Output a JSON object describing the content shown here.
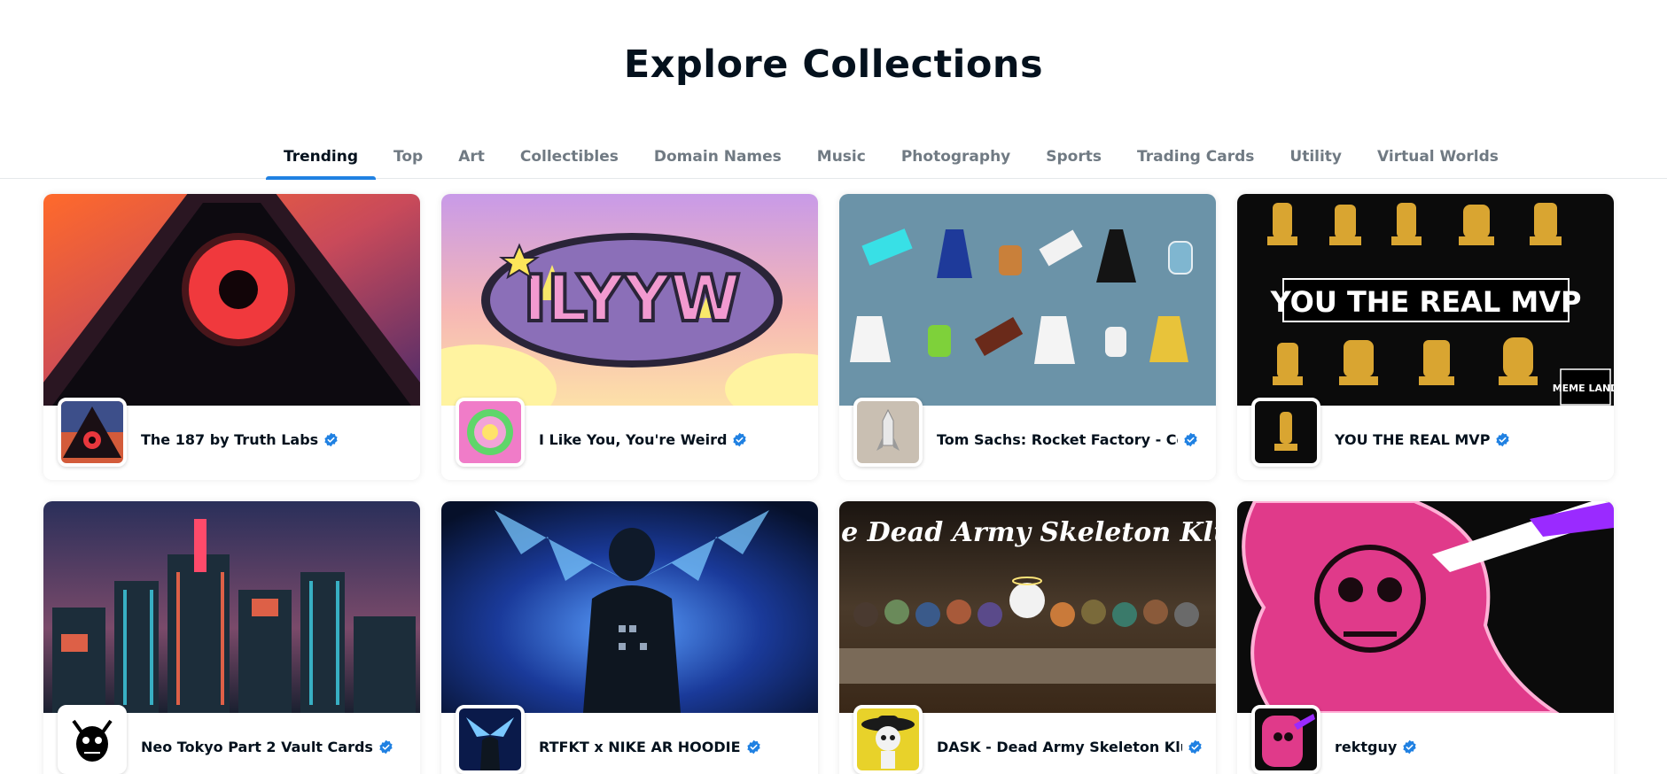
{
  "page": {
    "title": "Explore Collections"
  },
  "tabs": [
    {
      "label": "Trending",
      "active": true
    },
    {
      "label": "Top"
    },
    {
      "label": "Art"
    },
    {
      "label": "Collectibles"
    },
    {
      "label": "Domain Names"
    },
    {
      "label": "Music"
    },
    {
      "label": "Photography"
    },
    {
      "label": "Sports"
    },
    {
      "label": "Trading Cards"
    },
    {
      "label": "Utility"
    },
    {
      "label": "Virtual Worlds"
    }
  ],
  "collections": [
    {
      "name": "The 187 by Truth Labs",
      "verified": true,
      "banner_icon": "red-eye-pyramid-artwork",
      "avatar_icon": "pyramid-eye-avatar"
    },
    {
      "name": "I Like You, You're Weird",
      "verified": true,
      "banner_icon": "ilyyw-rainbow-logo-artwork",
      "banner_text": "ILYYW",
      "avatar_icon": "pink-green-badge-avatar"
    },
    {
      "name": "Tom Sachs: Rocket Factory - Com",
      "verified": true,
      "banner_icon": "rocket-parts-grid-artwork",
      "avatar_icon": "rocket-avatar"
    },
    {
      "name": "YOU THE REAL MVP",
      "verified": true,
      "banner_icon": "golden-trophies-artwork",
      "banner_text": "YOU THE REAL MVP",
      "banner_badge": "MEME LAND",
      "avatar_icon": "golden-trophy-avatar"
    },
    {
      "name": "Neo Tokyo Part 2 Vault Cards",
      "verified": true,
      "banner_icon": "neon-city-artwork",
      "avatar_icon": "demon-face-avatar"
    },
    {
      "name": "RTFKT x NIKE AR HOODIE",
      "verified": true,
      "banner_icon": "winged-hoodie-artwork",
      "avatar_icon": "winged-hoodie-avatar"
    },
    {
      "name": "DASK - Dead Army Skeleton Klub",
      "verified": true,
      "banner_icon": "skeleton-last-supper-artwork",
      "banner_text": "The Dead Army Skeleton Kluf.",
      "avatar_icon": "skeleton-sombrero-avatar"
    },
    {
      "name": "rektguy",
      "verified": true,
      "banner_icon": "pink-skull-ghost-artwork",
      "avatar_icon": "pink-skull-avatar"
    }
  ],
  "colors": {
    "accent": "#2081e2",
    "verified": "#2081e2",
    "title_text": "#04111d",
    "muted_text": "#707a83"
  },
  "icons": {
    "verified": "verified-badge-icon"
  }
}
